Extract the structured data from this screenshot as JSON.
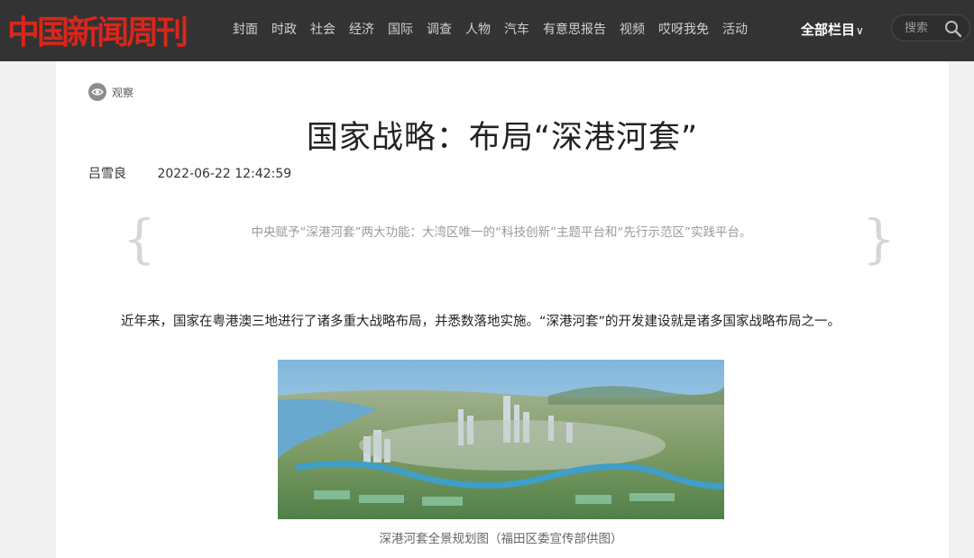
{
  "brand": {
    "logo_text": "中国新闻周刊",
    "accent": "#d9261c"
  },
  "nav": {
    "items": [
      "封面",
      "时政",
      "社会",
      "经济",
      "国际",
      "调查",
      "人物",
      "汽车",
      "有意思报告",
      "视频",
      "哎呀我免",
      "活动"
    ],
    "all_columns": "全部栏目",
    "all_columns_icon": "chevron-down-icon"
  },
  "search": {
    "placeholder": "搜索",
    "icon": "search-icon"
  },
  "article": {
    "column": "观察",
    "column_icon": "eye-icon",
    "title": "国家战略：布局“深港河套”",
    "author": "吕雪良",
    "datetime": "2022-06-22 12:42:59",
    "summary": "中央赋予“深港河套”两大功能：大湾区唯一的“科技创新”主题平台和“先行示范区”实践平台。",
    "paragraph": "近年来，国家在粤港澳三地进行了诸多重大战略布局，并悉数落地实施。“深港河套”的开发建设就是诸多国家战略布局之一。",
    "image_caption": "深港河套全景规划图（福田区委宣传部供图）"
  }
}
